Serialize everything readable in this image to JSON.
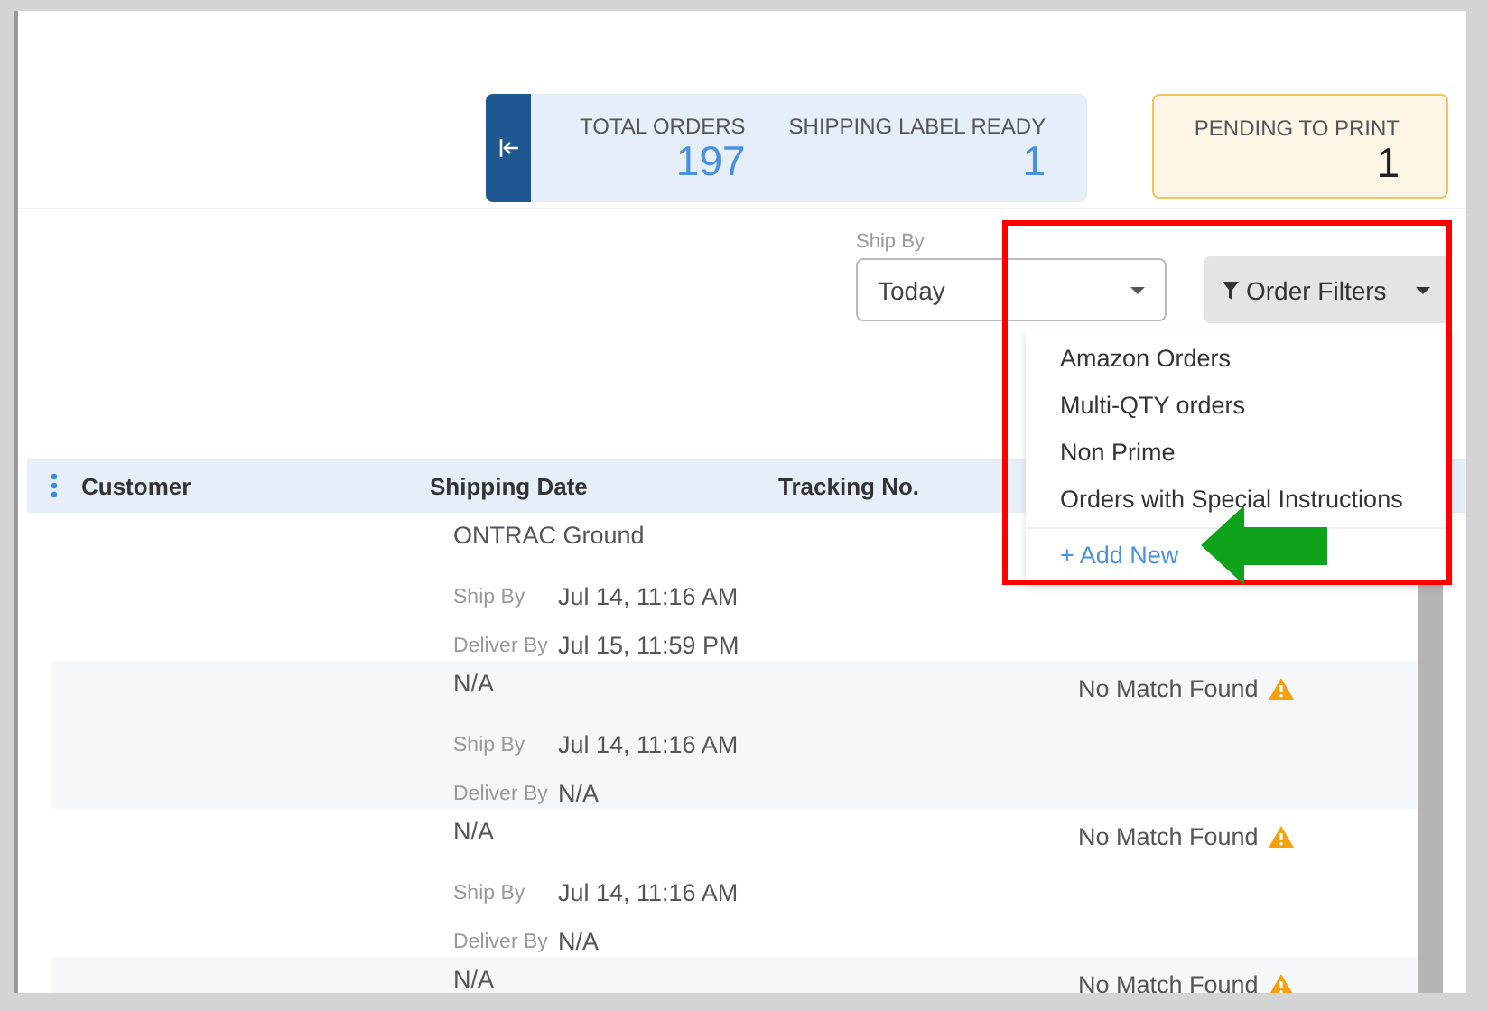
{
  "summary": {
    "stats": [
      {
        "label": "TOTAL ORDERS",
        "value": "197"
      },
      {
        "label": "SHIPPING LABEL READY",
        "value": "1"
      }
    ],
    "pending": {
      "label": "PENDING TO PRINT",
      "value": "1"
    }
  },
  "ship_by": {
    "label": "Ship By",
    "value": "Today"
  },
  "order_filters": {
    "label": "Order Filters",
    "expanded": true,
    "options": [
      "Amazon Orders",
      "Multi-QTY orders",
      "Non Prime",
      "Orders with Special Instructions"
    ],
    "add_new": "+ Add New"
  },
  "table": {
    "columns": [
      "Customer",
      "Shipping Date",
      "Tracking No."
    ],
    "rows": [
      {
        "carrier": "ONTRAC Ground",
        "ship_by_label": "Ship By",
        "ship_by": "Jul 14, 11:16 AM",
        "deliver_by_label": "Deliver By",
        "deliver_by": "Jul 15, 11:59 PM"
      },
      {
        "carrier": "N/A",
        "ship_by_label": "Ship By",
        "ship_by": "Jul 14, 11:16 AM",
        "deliver_by_label": "Deliver By",
        "deliver_by": "N/A",
        "column_4": "No Match Found"
      },
      {
        "carrier": "N/A",
        "ship_by_label": "Ship By",
        "ship_by": "Jul 14, 11:16 AM",
        "deliver_by_label": "Deliver By",
        "deliver_by": "N/A",
        "column_4": "No Match Found"
      },
      {
        "carrier": "N/A",
        "column_4": "No Match Found"
      }
    ]
  }
}
